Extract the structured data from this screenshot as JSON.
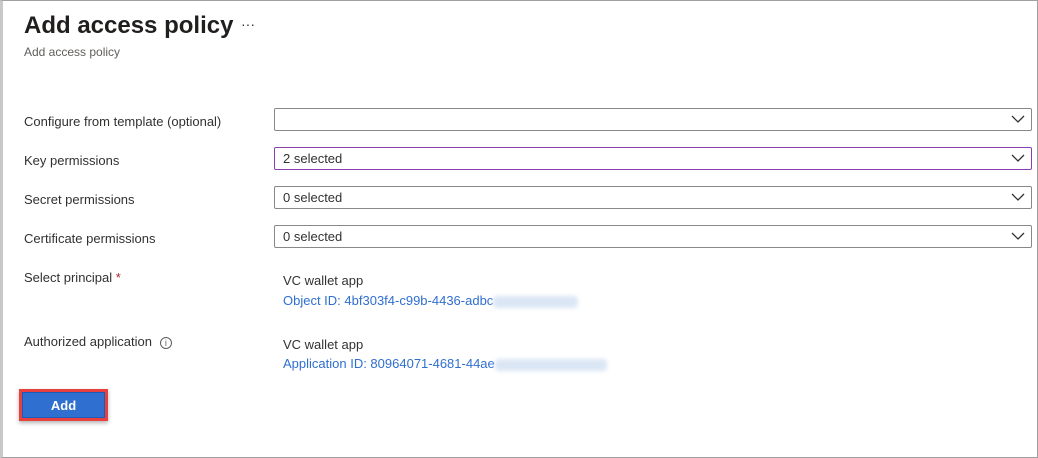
{
  "header": {
    "title": "Add access policy",
    "subtitle": "Add access policy",
    "more": "···"
  },
  "form": {
    "template": {
      "label": "Configure from template (optional)",
      "value": ""
    },
    "key": {
      "label": "Key permissions",
      "value": "2 selected"
    },
    "secret": {
      "label": "Secret permissions",
      "value": "0 selected"
    },
    "certificate": {
      "label": "Certificate permissions",
      "value": "0 selected"
    },
    "principal": {
      "label": "Select principal",
      "required": "*",
      "name": "VC wallet app",
      "id": "Object ID: 4bf303f4-c99b-4436-adbc"
    },
    "authorized": {
      "label": "Authorized application",
      "info": "i",
      "name": "VC wallet app",
      "id": "Application ID: 80964071-4681-44ae"
    }
  },
  "add_label": "Add"
}
